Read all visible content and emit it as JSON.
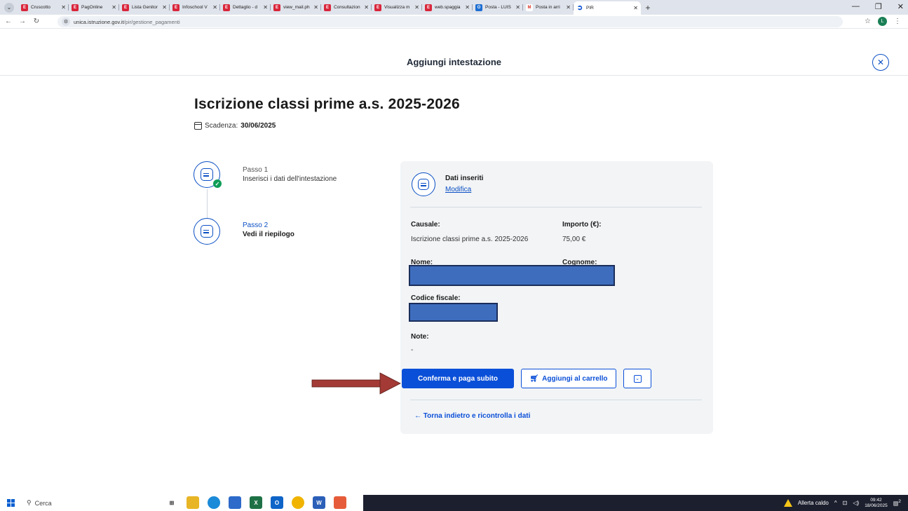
{
  "browser": {
    "tabs": [
      {
        "title": "Cruscotto",
        "icon": "red"
      },
      {
        "title": "PagOnline",
        "icon": "red"
      },
      {
        "title": "Lista Genitor",
        "icon": "red"
      },
      {
        "title": "Infoschool V",
        "icon": "red"
      },
      {
        "title": "Dettaglio - d",
        "icon": "red"
      },
      {
        "title": "view_mail.ph",
        "icon": "red"
      },
      {
        "title": "Consultazion",
        "icon": "red"
      },
      {
        "title": "Visualizza m",
        "icon": "red"
      },
      {
        "title": "web.spaggia",
        "icon": "red"
      },
      {
        "title": "Posta - LUIS",
        "icon": "outlook"
      },
      {
        "title": "Posta in arri",
        "icon": "gmail"
      }
    ],
    "active_tab": {
      "title": "PIR"
    },
    "url_domain": "unica.istruzione.gov.it",
    "url_path": "/pir/gestione_pagamenti",
    "profile_initial": "L"
  },
  "page": {
    "header_title": "Aggiungi intestazione",
    "title": "Iscrizione classi prime a.s. 2025-2026",
    "deadline_label": "Scadenza:",
    "deadline_value": "30/06/2025"
  },
  "steps": [
    {
      "label": "Passo 1",
      "description": "Inserisci i dati dell'intestazione"
    },
    {
      "label": "Passo 2",
      "description": "Vedi il riepilogo"
    }
  ],
  "summary": {
    "heading": "Dati inseriti",
    "edit_link": "Modifica",
    "causale_label": "Causale:",
    "causale_value": "Iscrizione classi prime a.s. 2025-2026",
    "importo_label": "Importo (€):",
    "importo_value": "75,00 €",
    "nome_label": "Nome:",
    "cognome_label": "Cognome:",
    "codice_fiscale_label": "Codice fiscale:",
    "note_label": "Note:",
    "note_value": "-",
    "confirm_button": "Conferma e paga subito",
    "cart_button": "Aggiungi al carrello",
    "back_link": "Torna indietro e ricontrolla i dati"
  },
  "taskbar": {
    "search_placeholder": "Cerca",
    "weather_alert": "Allerta caldo",
    "time": "09:42",
    "date": "18/06/2025",
    "notification_count": "2"
  },
  "colors": {
    "primary": "#0a4fd8",
    "success": "#0f9d58",
    "card_bg": "#f2f4f6",
    "annotation_arrow": "#a33a35"
  }
}
